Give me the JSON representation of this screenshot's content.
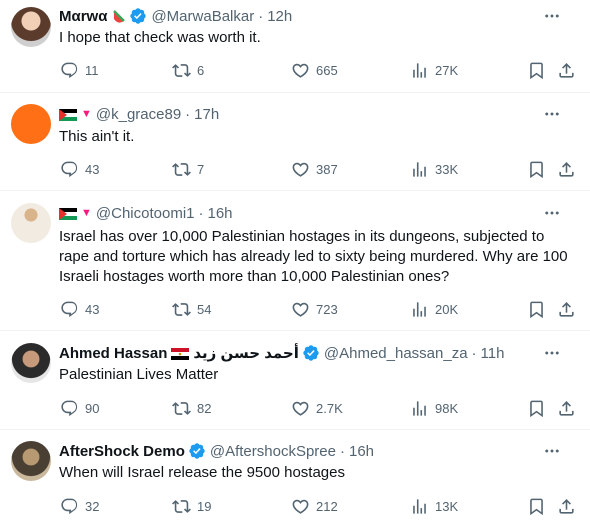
{
  "tweets": [
    {
      "name": "Mαrwα",
      "handle": "@MarwaBalkar",
      "time": "12h",
      "text": "I hope that check was worth it.",
      "replies": "11",
      "retweets": "6",
      "likes": "665",
      "views": "27K"
    },
    {
      "name": "",
      "handle": "@k_grace89",
      "time": "17h",
      "text": "This ain't it.",
      "replies": "43",
      "retweets": "7",
      "likes": "387",
      "views": "33K"
    },
    {
      "name": "",
      "handle": "@Chicotoomi1",
      "time": "16h",
      "text": "Israel has over 10,000 Palestinian hostages in its dungeons, subjected to rape and torture which has already led to sixty being murdered. Why are 100 Israeli hostages worth more than 10,000 Palestinian ones?",
      "replies": "43",
      "retweets": "54",
      "likes": "723",
      "views": "20K"
    },
    {
      "name": "Ahmed Hassan",
      "name_ar": "أحمد حسن زيد",
      "handle": "@Ahmed_hassan_za",
      "time": "11h",
      "text": "Palestinian Lives Matter",
      "replies": "90",
      "retweets": "82",
      "likes": "2.7K",
      "views": "98K"
    },
    {
      "name": "AfterShock Demo",
      "handle": "@AftershockSpree",
      "time": "16h",
      "text": "When will Israel release the 9500 hostages",
      "replies": "32",
      "retweets": "19",
      "likes": "212",
      "views": "13K"
    }
  ],
  "icons": {
    "reply": "reply-icon",
    "retweet": "retweet-icon",
    "like": "heart-icon",
    "views": "views-icon",
    "bookmark": "bookmark-icon",
    "share": "share-icon",
    "more": "more-icon",
    "verified": "verified-badge-icon"
  },
  "colors": {
    "verified": "#1d9bf0",
    "secondary_text": "#536471",
    "divider": "#eff3f4",
    "orange_avatar": "#ff6f15"
  }
}
